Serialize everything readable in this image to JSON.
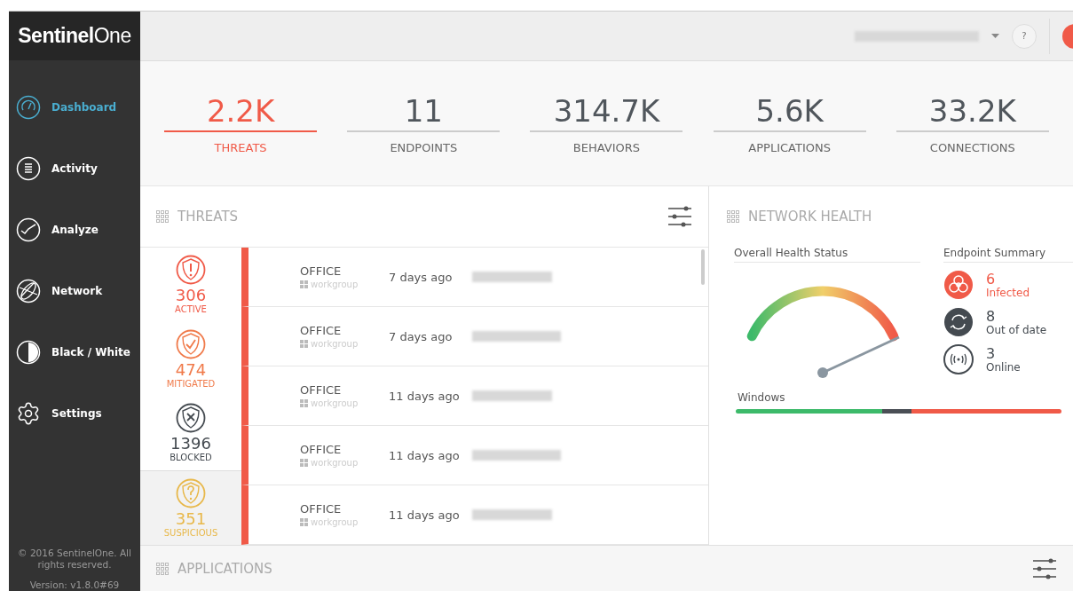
{
  "logo": {
    "brand": "Sentinel",
    "suffix": "One"
  },
  "sidebar": {
    "items": [
      {
        "label": "Dashboard",
        "kind": "gauge",
        "selected": true
      },
      {
        "label": "Activity",
        "kind": "list",
        "selected": false
      },
      {
        "label": "Analyze",
        "kind": "chart",
        "selected": false
      },
      {
        "label": "Network",
        "kind": "globe",
        "selected": false
      },
      {
        "label": "Black / White",
        "kind": "contrast",
        "selected": false
      },
      {
        "label": "Settings",
        "kind": "gear",
        "selected": false
      }
    ],
    "copyright": "© 2016 SentinelOne. All rights reserved.",
    "version": "Version: v1.8.0#69"
  },
  "header": {
    "help": "?"
  },
  "stats": [
    {
      "value": "2.2K",
      "label": "THREATS",
      "selected": true
    },
    {
      "value": "11",
      "label": "ENDPOINTS",
      "selected": false
    },
    {
      "value": "314.7K",
      "label": "BEHAVIORS",
      "selected": false
    },
    {
      "value": "5.6K",
      "label": "APPLICATIONS",
      "selected": false
    },
    {
      "value": "33.2K",
      "label": "CONNECTIONS",
      "selected": false
    }
  ],
  "threats": {
    "title": "THREATS",
    "categories": [
      {
        "count": "306",
        "label": "ACTIVE",
        "kind": "alert",
        "color": "#f05a48",
        "selected": false
      },
      {
        "count": "474",
        "label": "MITIGATED",
        "kind": "check",
        "color": "#f07a4a",
        "selected": false
      },
      {
        "count": "1396",
        "label": "BLOCKED",
        "kind": "cross",
        "color": "#444a50",
        "selected": false
      },
      {
        "count": "351",
        "label": "SUSPICIOUS",
        "kind": "question",
        "color": "#e8b84a",
        "selected": true
      }
    ],
    "rows": [
      {
        "name": "OFFICE",
        "group": "workgroup",
        "time": "7 days ago"
      },
      {
        "name": "OFFICE",
        "group": "workgroup",
        "time": "7 days ago"
      },
      {
        "name": "OFFICE",
        "group": "workgroup",
        "time": "11 days ago"
      },
      {
        "name": "OFFICE",
        "group": "workgroup",
        "time": "11 days ago"
      },
      {
        "name": "OFFICE",
        "group": "workgroup",
        "time": "11 days ago"
      }
    ]
  },
  "network_health": {
    "title": "NETWORK HEALTH",
    "overall_title": "Overall Health Status",
    "summary_title": "Endpoint Summary",
    "summary": [
      {
        "count": "6",
        "label": "Infected",
        "kind": "infected",
        "color": "#f05a48"
      },
      {
        "count": "8",
        "label": "Out of date",
        "kind": "outdated",
        "color": "#444a50"
      },
      {
        "count": "3",
        "label": "Online",
        "kind": "online",
        "color": "#444a50"
      }
    ],
    "os_label": "Windows",
    "os_segments": [
      {
        "color": "#3dba6a"
      },
      {
        "color": "#4a4f55"
      },
      {
        "color": "#f05a48"
      }
    ]
  },
  "applications": {
    "title": "APPLICATIONS"
  }
}
